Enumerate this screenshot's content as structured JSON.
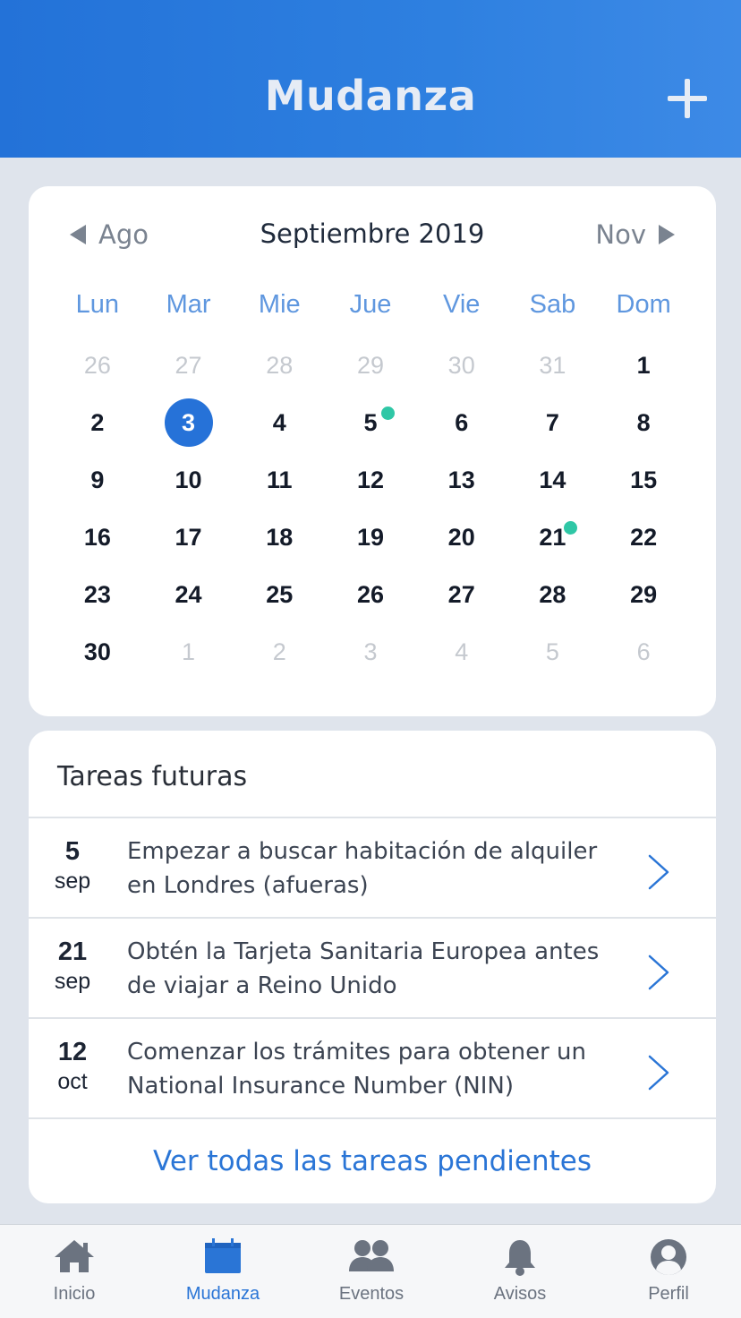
{
  "header": {
    "title": "Mudanza",
    "add_icon": "plus-icon"
  },
  "calendar": {
    "prev_label": "Ago",
    "next_label": "Nov",
    "month_title": "Septiembre 2019",
    "weekdays": [
      "Lun",
      "Mar",
      "Mie",
      "Jue",
      "Vie",
      "Sab",
      "Dom"
    ],
    "days": [
      {
        "n": "26",
        "muted": true
      },
      {
        "n": "27",
        "muted": true
      },
      {
        "n": "28",
        "muted": true
      },
      {
        "n": "29",
        "muted": true
      },
      {
        "n": "30",
        "muted": true
      },
      {
        "n": "31",
        "muted": true
      },
      {
        "n": "1"
      },
      {
        "n": "2"
      },
      {
        "n": "3",
        "selected": true
      },
      {
        "n": "4"
      },
      {
        "n": "5",
        "event": true
      },
      {
        "n": "6"
      },
      {
        "n": "7"
      },
      {
        "n": "8"
      },
      {
        "n": "9"
      },
      {
        "n": "10"
      },
      {
        "n": "11"
      },
      {
        "n": "12"
      },
      {
        "n": "13"
      },
      {
        "n": "14"
      },
      {
        "n": "15"
      },
      {
        "n": "16"
      },
      {
        "n": "17"
      },
      {
        "n": "18"
      },
      {
        "n": "19"
      },
      {
        "n": "20"
      },
      {
        "n": "21",
        "event": true
      },
      {
        "n": "22"
      },
      {
        "n": "23"
      },
      {
        "n": "24"
      },
      {
        "n": "25"
      },
      {
        "n": "26"
      },
      {
        "n": "27"
      },
      {
        "n": "28"
      },
      {
        "n": "29"
      },
      {
        "n": "30"
      },
      {
        "n": "1",
        "muted": true
      },
      {
        "n": "2",
        "muted": true
      },
      {
        "n": "3",
        "muted": true
      },
      {
        "n": "4",
        "muted": true
      },
      {
        "n": "5",
        "muted": true
      },
      {
        "n": "6",
        "muted": true
      }
    ],
    "colors": {
      "selected": "#2672d8",
      "event_dot": "#2fc7a6",
      "weekday": "#5f97df"
    }
  },
  "tasks": {
    "title": "Tareas futuras",
    "items": [
      {
        "day": "5",
        "month": "sep",
        "text": "Empezar a buscar habitación de alquiler en Londres (afueras)"
      },
      {
        "day": "21",
        "month": "sep",
        "text": "Obtén la Tarjeta Sanitaria Europea antes de viajar a Reino Unido"
      },
      {
        "day": "12",
        "month": "oct",
        "text": "Comenzar los trámites para obtener un National Insurance Number (NIN)"
      }
    ],
    "view_all": "Ver todas las tareas pendientes"
  },
  "tabbar": {
    "items": [
      {
        "label": "Inicio",
        "icon": "home-icon"
      },
      {
        "label": "Mudanza",
        "icon": "calendar-icon",
        "active": true
      },
      {
        "label": "Eventos",
        "icon": "people-icon"
      },
      {
        "label": "Avisos",
        "icon": "bell-icon"
      },
      {
        "label": "Perfil",
        "icon": "profile-icon"
      }
    ]
  }
}
